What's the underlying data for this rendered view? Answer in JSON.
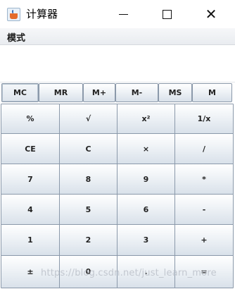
{
  "window": {
    "title": "计算器",
    "minimize_label": "—",
    "maximize_label": "☐",
    "close_label": "✕"
  },
  "menu": {
    "items": [
      "模式"
    ]
  },
  "display": {
    "value": ""
  },
  "memory_buttons": [
    "MC",
    "MR",
    "M+",
    "M-",
    "MS",
    "M"
  ],
  "keypad": [
    [
      "%",
      "√",
      "x²",
      "1/x"
    ],
    [
      "CE",
      "C",
      "×",
      "/"
    ],
    [
      "7",
      "8",
      "9",
      "*"
    ],
    [
      "4",
      "5",
      "6",
      "-"
    ],
    [
      "1",
      "2",
      "3",
      "+"
    ],
    [
      "±",
      "0",
      ".",
      "="
    ]
  ],
  "watermark": "https://blog.csdn.net/just_learn_more",
  "colors": {
    "button_border": "#8b99aa",
    "button_gradient_top": "#ffffff",
    "button_gradient_bottom": "#d9e1ea",
    "menubar_bg": "#eceff2"
  }
}
